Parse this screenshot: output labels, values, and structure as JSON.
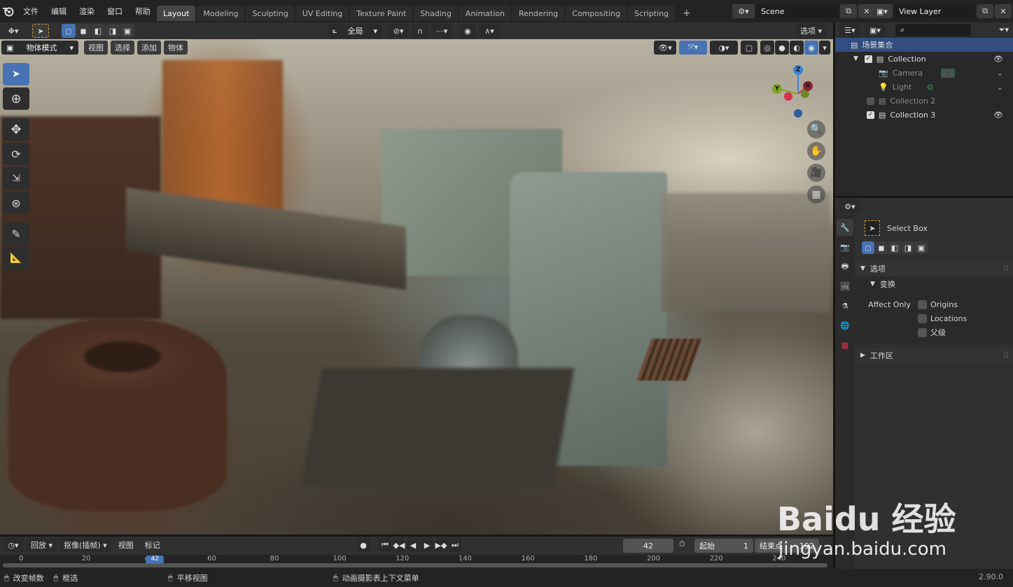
{
  "menu": [
    "文件",
    "编辑",
    "渲染",
    "窗口",
    "帮助"
  ],
  "workspaces": [
    "Layout",
    "Modeling",
    "Sculpting",
    "UV Editing",
    "Texture Paint",
    "Shading",
    "Animation",
    "Rendering",
    "Compositing",
    "Scripting"
  ],
  "workspace_add": "+",
  "scene": {
    "label": "Scene"
  },
  "view_layer": {
    "label": "View Layer"
  },
  "header2": {
    "transform_orientation": "全局",
    "options": "选项"
  },
  "viewport_header": {
    "mode": "物体模式",
    "menus": [
      "视图",
      "选择",
      "添加",
      "物体"
    ]
  },
  "gizmo": {
    "z": "Z",
    "x": "X",
    "y": "Y"
  },
  "outliner": {
    "search_placeholder": "",
    "scene_collection": "场景集合",
    "items": [
      {
        "label": "Collection",
        "checked": true
      },
      {
        "label": "Camera"
      },
      {
        "label": "Light"
      },
      {
        "label": "Collection 2",
        "checked": false
      },
      {
        "label": "Collection 3",
        "checked": true
      }
    ]
  },
  "properties": {
    "tool_name": "Select Box",
    "panel_options": "选项",
    "sub_transform": "变换",
    "affect_only": "Affect Only",
    "origins": "Origins",
    "locations": "Locations",
    "parents": "父级",
    "workspace": "工作区"
  },
  "timeline": {
    "playback": "回放",
    "keying": "抠像(插帧)",
    "view": "视图",
    "marker": "标记",
    "current_frame": "42",
    "start_label": "起始",
    "start": "1",
    "end_label": "结束点",
    "end": "192",
    "ticks": [
      "0",
      "20",
      "40",
      "60",
      "80",
      "100",
      "120",
      "140",
      "160",
      "180",
      "200",
      "220",
      "240"
    ],
    "ticks_values": [
      0,
      20,
      40,
      60,
      80,
      100,
      120,
      140,
      160,
      180,
      200,
      220,
      240
    ],
    "current_value": 42
  },
  "status": {
    "left": "改变帧数",
    "box": "框选",
    "pan": "平移视图",
    "context": "动画摄影表上下文菜单",
    "version": "2.90.0"
  },
  "watermark": {
    "brand": "Baidu 经验",
    "url": "jingyan.baidu.com"
  },
  "colors": {
    "accent": "#4772b3",
    "header": "#232323",
    "panel": "#2b2b2b",
    "axis_x": "#d8304a",
    "axis_y": "#7fa32a",
    "axis_z": "#3a84d6"
  }
}
